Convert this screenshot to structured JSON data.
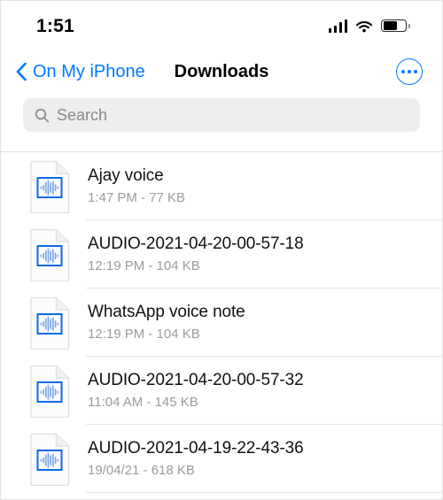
{
  "status_bar": {
    "time": "1:51",
    "signal_icon": "cellular-signal-icon",
    "wifi_icon": "wifi-icon",
    "battery_icon": "battery-icon",
    "battery_level_percent": 62
  },
  "nav_bar": {
    "back_label": "On My iPhone",
    "back_icon": "chevron-left-icon",
    "title": "Downloads",
    "more_icon": "ellipsis-circle-icon"
  },
  "search": {
    "placeholder": "Search",
    "value": "",
    "icon": "search-icon"
  },
  "colors": {
    "accent": "#007aff",
    "title_text": "#000000",
    "meta_text": "#9b9b9f",
    "search_bg": "#eeeeef",
    "separator": "#e3e3e5"
  },
  "file_list": {
    "item_icon": "audio-file-icon",
    "items": [
      {
        "name": "Ajay voice",
        "meta": "1:47 PM - 77 KB"
      },
      {
        "name": "AUDIO-2021-04-20-00-57-18",
        "meta": "12:19 PM - 104 KB"
      },
      {
        "name": "WhatsApp voice note",
        "meta": "12:19 PM - 104 KB"
      },
      {
        "name": "AUDIO-2021-04-20-00-57-32",
        "meta": "11:04 AM - 145 KB"
      },
      {
        "name": "AUDIO-2021-04-19-22-43-36",
        "meta": "19/04/21 - 618 KB"
      }
    ]
  }
}
